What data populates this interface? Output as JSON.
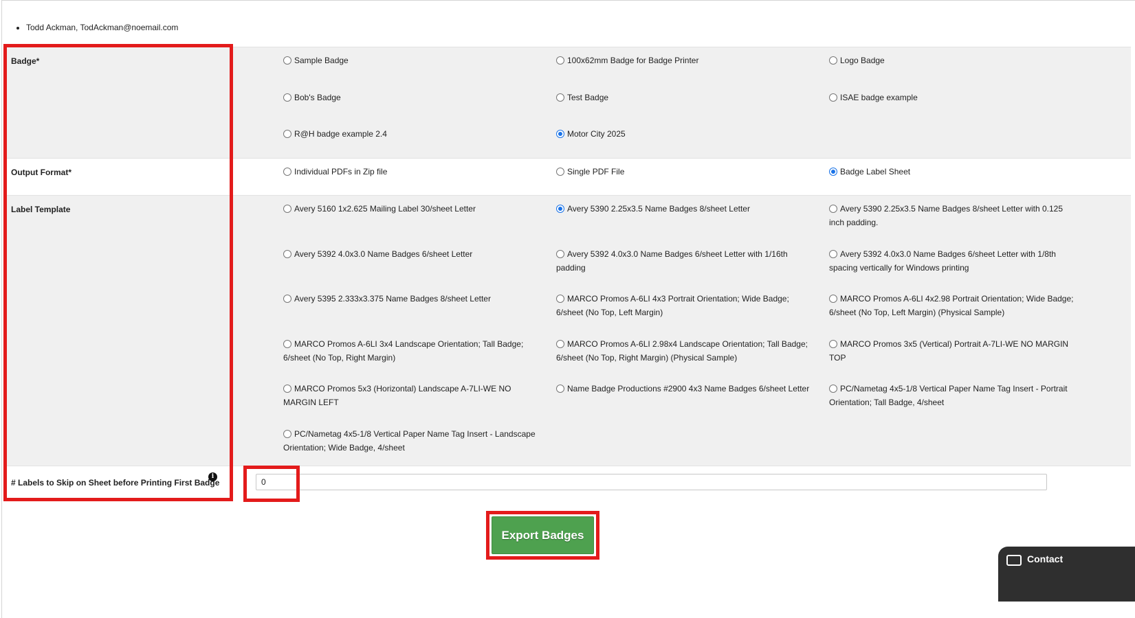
{
  "recipients": [
    "Todd Ackman, TodAckman@noemail.com"
  ],
  "badge": {
    "label": "Badge*",
    "options": [
      {
        "label": "Sample Badge",
        "checked": false
      },
      {
        "label": "100x62mm Badge for Badge Printer",
        "checked": false
      },
      {
        "label": "Logo Badge",
        "checked": false
      },
      {
        "label": "Bob's Badge",
        "checked": false
      },
      {
        "label": "Test Badge",
        "checked": false
      },
      {
        "label": "ISAE badge example",
        "checked": false
      },
      {
        "label": "R@H badge example 2.4",
        "checked": false
      },
      {
        "label": "Motor City 2025",
        "checked": true
      }
    ]
  },
  "output_format": {
    "label": "Output Format*",
    "options": [
      {
        "label": "Individual PDFs in Zip file",
        "checked": false
      },
      {
        "label": "Single PDF File",
        "checked": false
      },
      {
        "label": "Badge Label Sheet",
        "checked": true
      }
    ]
  },
  "label_template": {
    "label": "Label Template",
    "options": [
      {
        "label": "Avery 5160 1x2.625 Mailing Label 30/sheet Letter",
        "checked": false
      },
      {
        "label": "Avery 5390 2.25x3.5 Name Badges 8/sheet Letter",
        "checked": true
      },
      {
        "label": "Avery 5390 2.25x3.5 Name Badges 8/sheet Letter with 0.125 inch padding.",
        "checked": false
      },
      {
        "label": "Avery 5392 4.0x3.0 Name Badges 6/sheet Letter",
        "checked": false
      },
      {
        "label": "Avery 5392 4.0x3.0 Name Badges 6/sheet Letter with 1/16th padding",
        "checked": false
      },
      {
        "label": "Avery 5392 4.0x3.0 Name Badges 6/sheet Letter with 1/8th spacing vertically for Windows printing",
        "checked": false
      },
      {
        "label": "Avery 5395 2.333x3.375 Name Badges 8/sheet Letter",
        "checked": false
      },
      {
        "label": "MARCO Promos A-6LI 4x3 Portrait Orientation; Wide Badge; 6/sheet (No Top, Left Margin)",
        "checked": false
      },
      {
        "label": "MARCO Promos A-6LI 4x2.98 Portrait Orientation; Wide Badge; 6/sheet (No Top, Left Margin) (Physical Sample)",
        "checked": false
      },
      {
        "label": "MARCO Promos A-6LI 3x4 Landscape Orientation; Tall Badge; 6/sheet (No Top, Right Margin)",
        "checked": false
      },
      {
        "label": "MARCO Promos A-6LI 2.98x4 Landscape Orientation; Tall Badge; 6/sheet (No Top, Right Margin) (Physical Sample)",
        "checked": false
      },
      {
        "label": "MARCO Promos 3x5 (Vertical) Portrait A-7LI-WE NO MARGIN TOP",
        "checked": false
      },
      {
        "label": "MARCO Promos 5x3 (Horizontal) Landscape A-7LI-WE NO MARGIN LEFT",
        "checked": false
      },
      {
        "label": "Name Badge Productions #2900 4x3 Name Badges 6/sheet Letter",
        "checked": false
      },
      {
        "label": "PC/Nametag 4x5-1/8 Vertical Paper Name Tag Insert - Portrait Orientation; Tall Badge, 4/sheet",
        "checked": false
      },
      {
        "label": "PC/Nametag 4x5-1/8 Vertical Paper Name Tag Insert - Landscape Orientation; Wide Badge, 4/sheet",
        "checked": false
      }
    ]
  },
  "skip": {
    "label": "# Labels to Skip on Sheet before Printing First Badge",
    "value": "0",
    "info_icon": "info-icon"
  },
  "export_button": "Export Badges",
  "chat_widget": {
    "icon": "envelope-icon",
    "text": "Contact"
  },
  "colors": {
    "accent_red": "#e31b1b",
    "button_green": "#4ea14f",
    "radio_blue": "#1a73e8",
    "band_gray": "#f0f0f0"
  }
}
